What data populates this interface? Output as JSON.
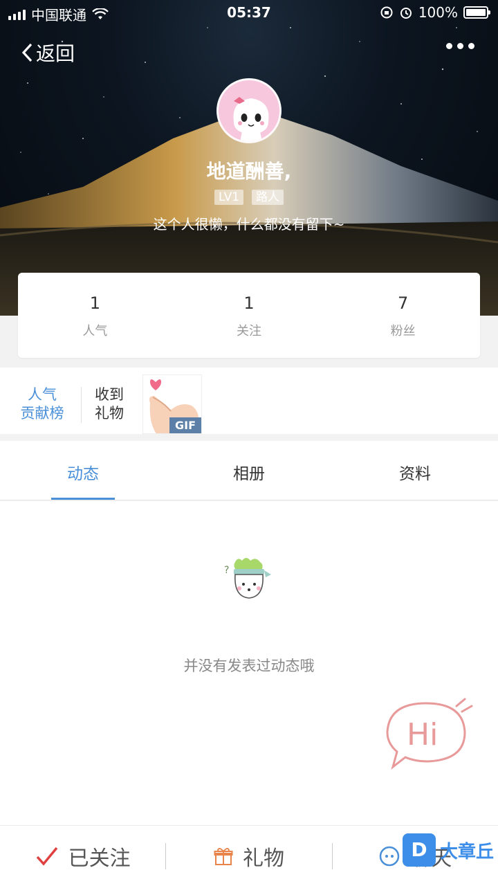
{
  "statusbar": {
    "carrier": "中国联通",
    "time": "05:37",
    "battery": "100%"
  },
  "nav": {
    "back_label": "返回"
  },
  "profile": {
    "nickname": "地道酬善,",
    "level_tag": "LV1",
    "role_tag": "路人",
    "bio": "这个人很懒，什么都没有留下~"
  },
  "stats": [
    {
      "value": "1",
      "label": "人气"
    },
    {
      "value": "1",
      "label": "关注"
    },
    {
      "value": "7",
      "label": "粉丝"
    }
  ],
  "gifts": {
    "rank_line1": "人气",
    "rank_line2": "贡献榜",
    "received_line1": "收到",
    "received_line2": "礼物",
    "gif_badge": "GIF"
  },
  "tabs": [
    {
      "label": "动态",
      "active": true
    },
    {
      "label": "相册",
      "active": false
    },
    {
      "label": "资料",
      "active": false
    }
  ],
  "content": {
    "empty_text": "并没有发表过动态哦",
    "hi_text": "Hi"
  },
  "bottombar": {
    "follow_label": "已关注",
    "gift_label": "礼物",
    "chat_label": "聊天"
  },
  "watermark": {
    "logo": "D",
    "text": "大章丘"
  },
  "colors": {
    "accent": "#4a90d9",
    "check": "#e04040",
    "gift_icon": "#e8834a",
    "hi": "#e89a9a"
  }
}
